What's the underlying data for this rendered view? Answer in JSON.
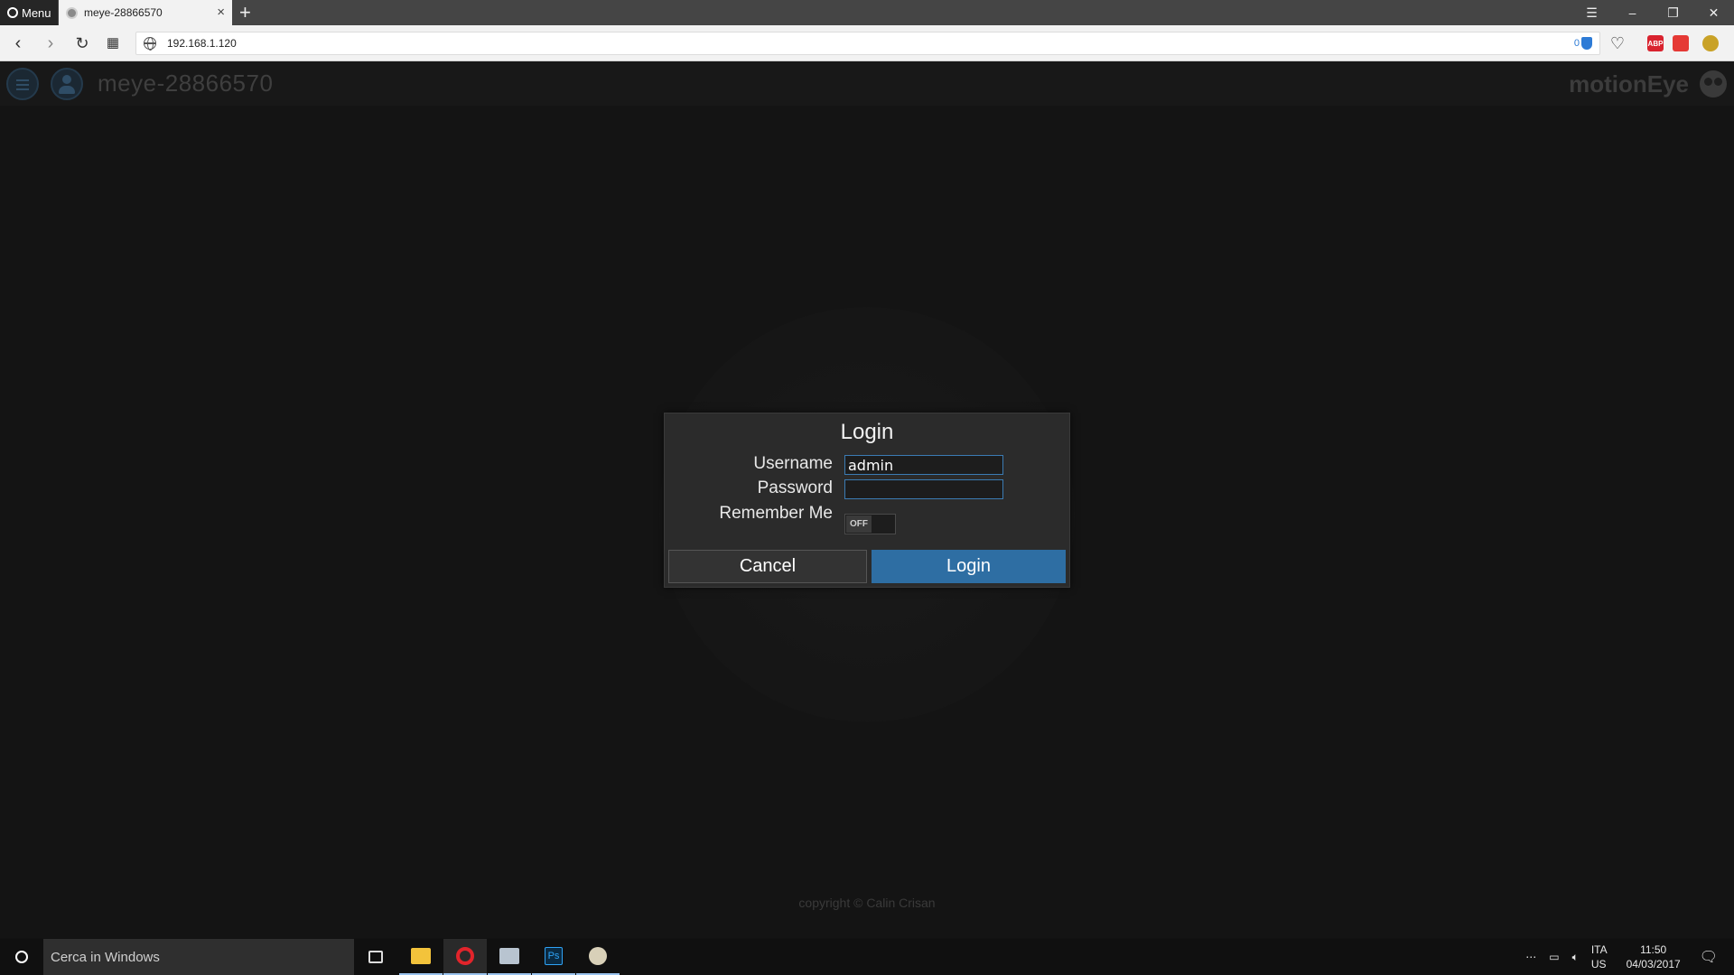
{
  "browser": {
    "menu_label": "Menu",
    "tab_title": "meye-28866570",
    "new_tab": "+",
    "url": "192.168.1.120",
    "blocker_count": "0",
    "extensions": [
      "ABP"
    ]
  },
  "app": {
    "device_name": "meye-28866570",
    "brand": "motionEye",
    "copyright": "copyright © Calin Crisan"
  },
  "login": {
    "title": "Login",
    "username_label": "Username",
    "username_value": "admin",
    "password_label": "Password",
    "password_value": "",
    "remember_label": "Remember Me",
    "remember_state": "OFF",
    "cancel_label": "Cancel",
    "login_label": "Login"
  },
  "taskbar": {
    "search_placeholder": "Cerca in Windows",
    "lang_line1": "ITA",
    "lang_line2": "US",
    "time": "11:50",
    "date": "04/03/2017"
  },
  "colors": {
    "accent": "#2e6ea3",
    "dialog_bg": "#2b2b2b",
    "page_bg": "#141414"
  }
}
